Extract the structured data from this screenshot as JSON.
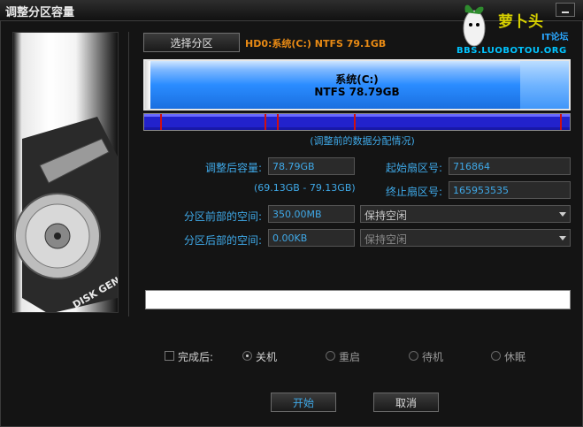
{
  "window": {
    "title": "调整分区容量"
  },
  "watermark": {
    "title": "萝卜头",
    "subtitle": "IT论坛",
    "url": "BBS.LUOBOTOU.ORG"
  },
  "partition": {
    "select_button": "选择分区",
    "info": "HD0:系统(C:) NTFS 79.1GB",
    "bar_name": "系统(C:)",
    "bar_size": "NTFS 78.79GB",
    "dist_caption": "(调整前的数据分配情况)"
  },
  "form": {
    "new_size_label": "调整后容量:",
    "new_size_value": "78.79GB",
    "size_range": "(69.13GB - 79.13GB)",
    "start_sector_label": "起始扇区号:",
    "start_sector_value": "716864",
    "end_sector_label": "终止扇区号:",
    "end_sector_value": "165953535",
    "before_space_label": "分区前部的空间:",
    "before_space_value": "350.00MB",
    "before_space_option": "保持空闲",
    "after_space_label": "分区后部的空间:",
    "after_space_value": "0.00KB",
    "after_space_option": "保持空闲"
  },
  "completion": {
    "checkbox_label": "完成后:",
    "options": [
      "关机",
      "重启",
      "待机",
      "休眠"
    ]
  },
  "buttons": {
    "start": "开始",
    "cancel": "取消"
  },
  "colors": {
    "accent": "#3fa9e8",
    "info_orange": "#e88a14",
    "bar_blue": "#1a6fe0",
    "dist_blue": "#2222cc",
    "dist_mark": "#d01010"
  },
  "icons": {
    "window_min": "minimize-icon",
    "dropdown": "chevron-down-icon"
  }
}
